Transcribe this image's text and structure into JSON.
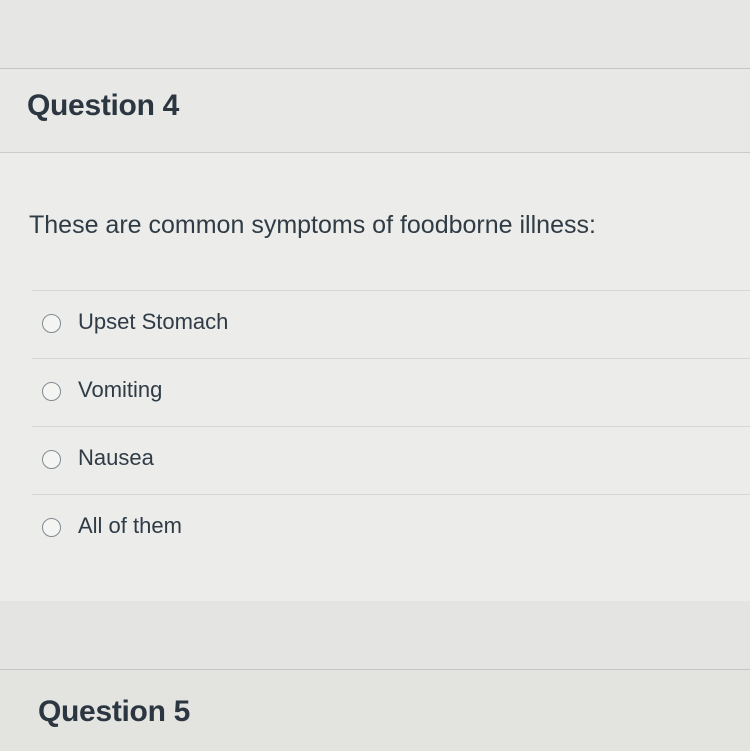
{
  "question4": {
    "title": "Question 4",
    "text": "These are common symptoms of foodborne illness:",
    "answers": [
      {
        "label": "Upset Stomach"
      },
      {
        "label": "Vomiting"
      },
      {
        "label": "Nausea"
      },
      {
        "label": "All of them"
      }
    ]
  },
  "question5": {
    "title": "Question 5"
  }
}
